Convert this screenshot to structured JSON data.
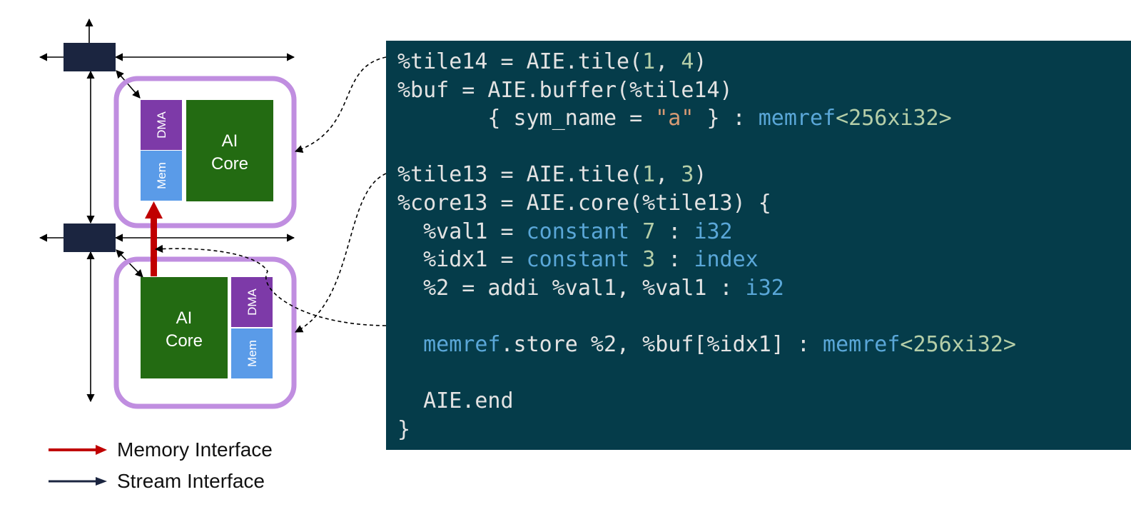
{
  "diagram": {
    "tiles": [
      {
        "id": "tile-top",
        "core_label_line1": "AI",
        "core_label_line2": "Core",
        "dma_label": "DMA",
        "mem_label": "Mem"
      },
      {
        "id": "tile-bottom",
        "core_label_line1": "AI",
        "core_label_line2": "Core",
        "dma_label": "DMA",
        "mem_label": "Mem"
      }
    ],
    "colors": {
      "tile_border": "#c08ee0",
      "core": "#236b12",
      "dma": "#7d3aa8",
      "mem": "#5a9be8",
      "switch": "#1b2540",
      "memory_arrow": "#c00000",
      "stream_arrow": "#1b2540",
      "code_bg": "#053c4a"
    }
  },
  "legend": {
    "memory_interface": "Memory Interface",
    "stream_interface": "Stream Interface"
  },
  "code": {
    "lines": [
      [
        {
          "t": "%tile14 = AIE.tile(",
          "c": "ident"
        },
        {
          "t": "1",
          "c": "num"
        },
        {
          "t": ", ",
          "c": "ident"
        },
        {
          "t": "4",
          "c": "num"
        },
        {
          "t": ")",
          "c": "ident"
        }
      ],
      [
        {
          "t": "%buf = AIE.buffer(%tile14)",
          "c": "ident"
        }
      ],
      [
        {
          "t": "       { sym_name = ",
          "c": "ident"
        },
        {
          "t": "\"a\"",
          "c": "str"
        },
        {
          "t": " } : ",
          "c": "ident"
        },
        {
          "t": "memref",
          "c": "kw"
        },
        {
          "t": "<256xi32>",
          "c": "num"
        }
      ],
      [],
      [
        {
          "t": "%tile13 = AIE.tile(",
          "c": "ident"
        },
        {
          "t": "1",
          "c": "num"
        },
        {
          "t": ", ",
          "c": "ident"
        },
        {
          "t": "3",
          "c": "num"
        },
        {
          "t": ")",
          "c": "ident"
        }
      ],
      [
        {
          "t": "%core13 = AIE.core(%tile13) {",
          "c": "ident"
        }
      ],
      [
        {
          "t": "  %val1 = ",
          "c": "ident"
        },
        {
          "t": "constant",
          "c": "kw"
        },
        {
          "t": " ",
          "c": "ident"
        },
        {
          "t": "7",
          "c": "num"
        },
        {
          "t": " : ",
          "c": "ident"
        },
        {
          "t": "i32",
          "c": "kw"
        }
      ],
      [
        {
          "t": "  %idx1 = ",
          "c": "ident"
        },
        {
          "t": "constant",
          "c": "kw"
        },
        {
          "t": " ",
          "c": "ident"
        },
        {
          "t": "3",
          "c": "num"
        },
        {
          "t": " : ",
          "c": "ident"
        },
        {
          "t": "index",
          "c": "kw"
        }
      ],
      [
        {
          "t": "  %2 = addi %val1, %val1 : ",
          "c": "ident"
        },
        {
          "t": "i32",
          "c": "kw"
        }
      ],
      [],
      [
        {
          "t": "  ",
          "c": "ident"
        },
        {
          "t": "memref",
          "c": "kw"
        },
        {
          "t": ".store %2, %buf[%idx1] : ",
          "c": "ident"
        },
        {
          "t": "memref",
          "c": "kw"
        },
        {
          "t": "<256xi32>",
          "c": "num"
        }
      ],
      [],
      [
        {
          "t": "  AIE.end",
          "c": "ident"
        }
      ],
      [
        {
          "t": "}",
          "c": "ident"
        }
      ]
    ]
  }
}
